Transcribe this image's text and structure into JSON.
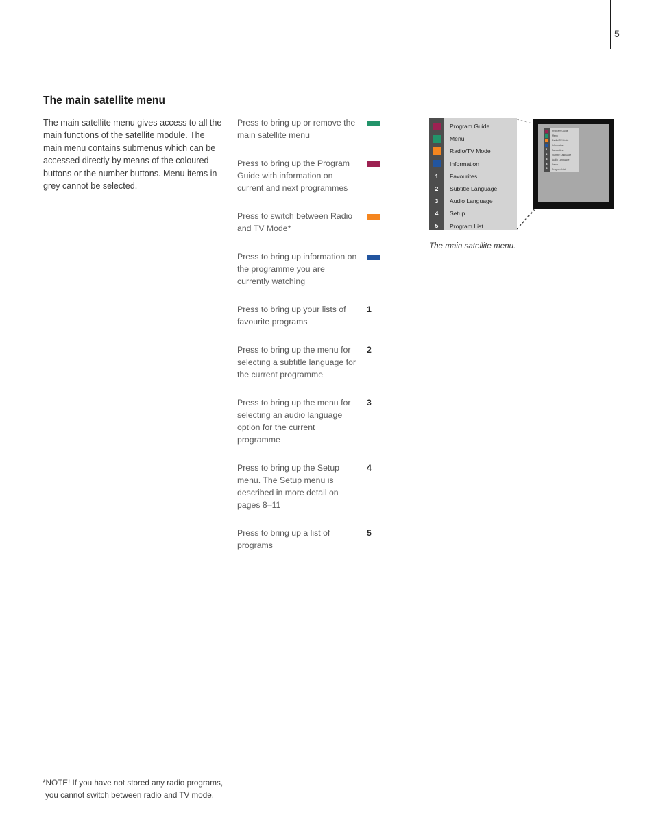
{
  "page": {
    "number": "5"
  },
  "headline": "The main satellite menu",
  "intro": "The main satellite menu gives access to all the main functions of the satellite module. The main menu contains submenus which can be accessed directly by means of the coloured buttons or the number buttons. Menu items in grey cannot be selected.",
  "colors": {
    "green": "#22946a",
    "magenta": "#9d2152",
    "orange": "#f5861f",
    "blue": "#22559f",
    "strip": "#4d4d4d",
    "menu_body": "#d3d3d3",
    "tv_frame": "#111111",
    "tv_screen": "#a8a8a8"
  },
  "instructions": [
    {
      "text": "Press to bring up or remove the main satellite menu",
      "marker_type": "swatch",
      "marker": "green"
    },
    {
      "text": "Press to bring up the Program Guide with information on current and next programmes",
      "marker_type": "swatch",
      "marker": "magenta"
    },
    {
      "text": "Press to switch between Radio and TV Mode*",
      "marker_type": "swatch",
      "marker": "orange"
    },
    {
      "text": "Press to bring up information on the programme you are currently watching",
      "marker_type": "swatch",
      "marker": "blue"
    },
    {
      "text": "Press to bring up your lists of favourite programs",
      "marker_type": "number",
      "marker": "1"
    },
    {
      "text": "Press to bring up the menu for selecting a subtitle language for the current programme",
      "marker_type": "number",
      "marker": "2"
    },
    {
      "text": "Press to bring up the menu for selecting an audio language option for the current programme",
      "marker_type": "number",
      "marker": "3"
    },
    {
      "text": "Press to bring up the Setup menu. The Setup menu is described in more detail on pages 8–11",
      "marker_type": "number",
      "marker": "4"
    },
    {
      "text": "Press to bring up a list of programs",
      "marker_type": "number",
      "marker": "5"
    }
  ],
  "menu": {
    "items": [
      {
        "key_type": "color",
        "key": "magenta",
        "label": "Program Guide"
      },
      {
        "key_type": "color",
        "key": "green",
        "label": "Menu"
      },
      {
        "key_type": "color",
        "key": "orange",
        "label": "Radio/TV Mode"
      },
      {
        "key_type": "color",
        "key": "blue",
        "label": "Information"
      },
      {
        "key_type": "number",
        "key": "1",
        "label": "Favourites"
      },
      {
        "key_type": "number",
        "key": "2",
        "label": "Subtitle Language"
      },
      {
        "key_type": "number",
        "key": "3",
        "label": "Audio Language"
      },
      {
        "key_type": "number",
        "key": "4",
        "label": "Setup"
      },
      {
        "key_type": "number",
        "key": "5",
        "label": "Program List"
      }
    ]
  },
  "figure_caption": "The main satellite menu.",
  "footnote": {
    "line1": "*NOTE! If you have not stored any radio programs,",
    "line2": "you cannot switch between radio and TV mode."
  }
}
